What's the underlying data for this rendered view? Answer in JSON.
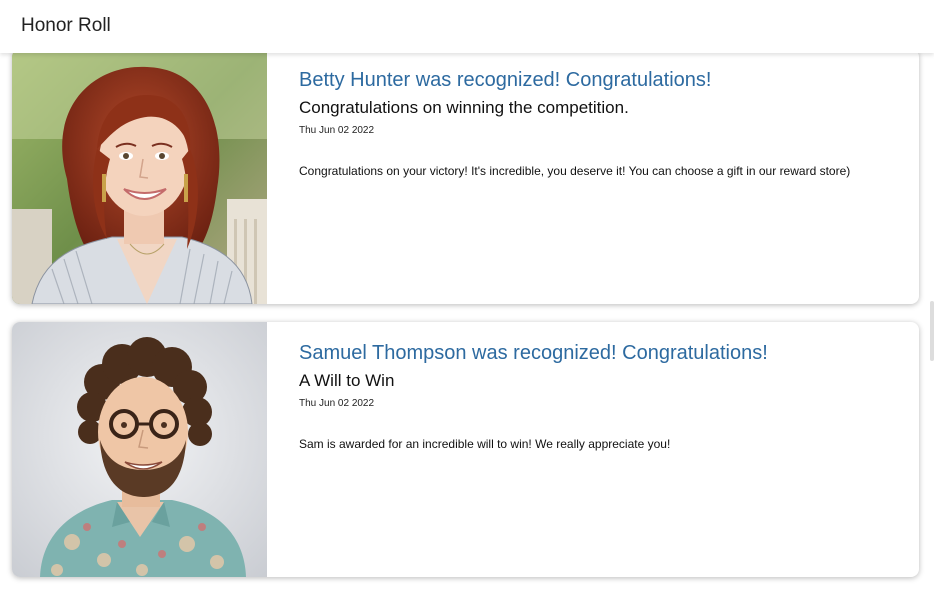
{
  "header": {
    "title": "Honor Roll"
  },
  "cards": [
    {
      "headline": "Betty Hunter was recognized! Congratulations!",
      "title": "Congratulations on winning the competition.",
      "date": "Thu Jun 02 2022",
      "message": "Congratulations on your victory! It's incredible, you deserve it! You can choose a gift in our reward store)"
    },
    {
      "headline": "Samuel Thompson was recognized! Congratulations!",
      "title": "A Will to Win",
      "date": "Thu Jun 02 2022",
      "message": "Sam is awarded for an incredible will to win! We really appreciate you!"
    }
  ],
  "colors": {
    "headline": "#2d6aa0",
    "header_bg": "#ffffff"
  }
}
